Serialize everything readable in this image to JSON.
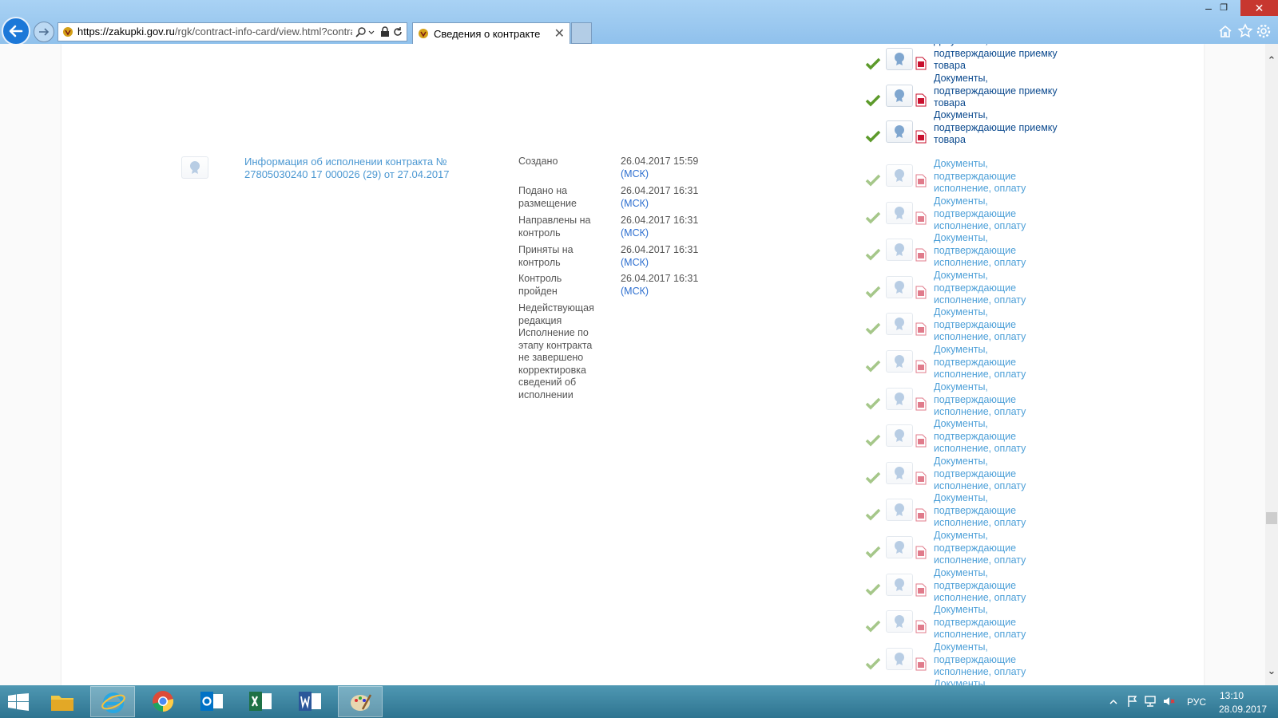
{
  "browser": {
    "window_controls": {
      "minimize": "–",
      "restore": "❐",
      "close": "✕"
    },
    "address": {
      "url_domain": "https://zakupki.gov.ru",
      "url_path": "/rgk/contract-info-card/view.html?contrac"
    },
    "tab": {
      "title": "Сведения о контракте",
      "close": "✕"
    }
  },
  "documents": {
    "goods_acceptance_label": "Документы, подтверждающие приемку товара",
    "payment_label": "Документы, подтверждающие исполнение, оплату",
    "partial_label": "Документы,"
  },
  "info_entry": {
    "title": "Информация об исполнении контракта № 27805030240 17 000026 (29) от 27.04.2017",
    "statuses": [
      {
        "label": "Создано",
        "date": "26.04.2017 15:59",
        "tz": "(МСК)"
      },
      {
        "label": "Подано на размещение",
        "date": "26.04.2017 16:31",
        "tz": "(МСК)"
      },
      {
        "label": "Направлены на контроль",
        "date": "26.04.2017 16:31",
        "tz": "(МСК)"
      },
      {
        "label": "Приняты на контроль",
        "date": "26.04.2017 16:31",
        "tz": "(МСК)"
      },
      {
        "label": "Контроль пройден",
        "date": "26.04.2017 16:31",
        "tz": "(МСК)"
      },
      {
        "label": "Недействующая редакция Исполнение по этапу контракта не завершено корректировка сведений об исполнении",
        "date": "",
        "tz": ""
      }
    ]
  },
  "scrollbar": {
    "up": "⌃",
    "down": "⌄"
  },
  "taskbar": {
    "lang": "РУС",
    "time": "13:10",
    "date": "28.09.2017"
  },
  "colors": {
    "link": "#1f5a9a",
    "link_light": "#4ea0d8",
    "check": "#5c9a2a",
    "pdf": "#c8102e",
    "close_button": "#c7372f"
  }
}
